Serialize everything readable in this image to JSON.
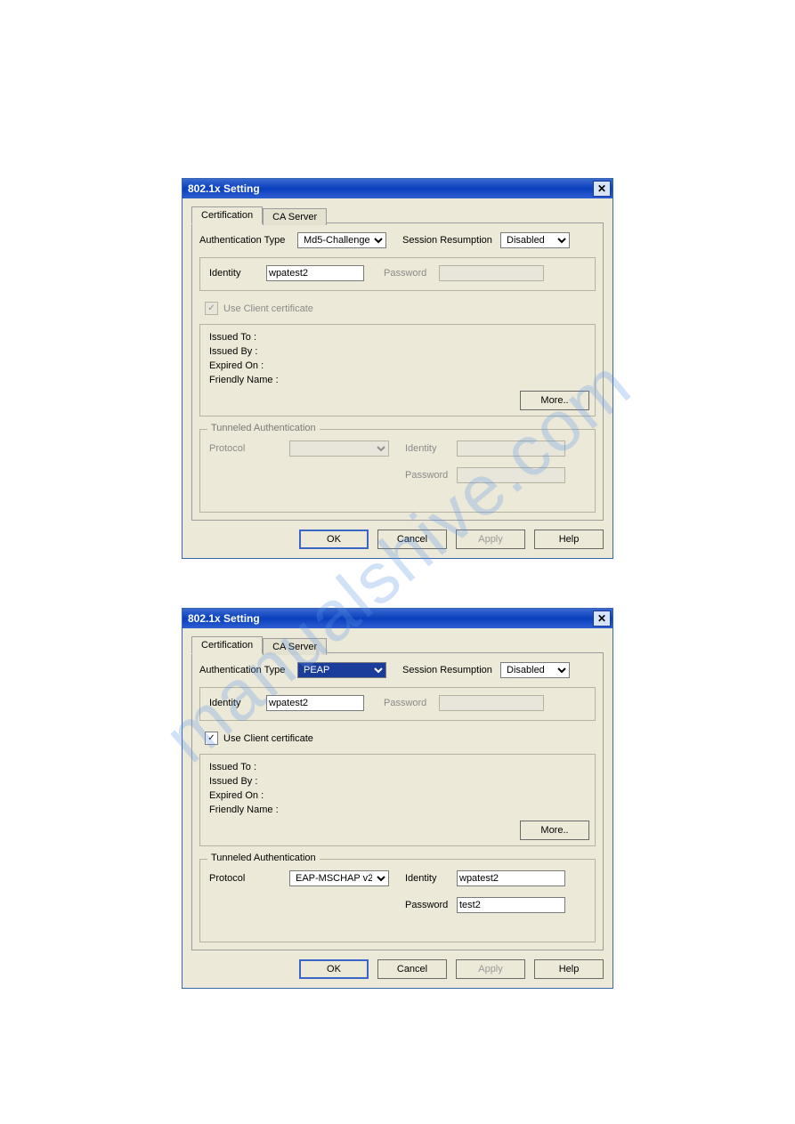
{
  "watermark": "manualshive.com",
  "dialog1": {
    "title": "802.1x Setting",
    "tabs": [
      "Certification",
      "CA Server"
    ],
    "active_tab": 0,
    "auth_type_label": "Authentication Type",
    "auth_type_value": "Md5-Challenge",
    "session_label": "Session Resumption",
    "session_value": "Disabled",
    "identity_label": "Identity",
    "identity_value": "wpatest2",
    "password_label": "Password",
    "password_value": "",
    "use_client_cert_label": "Use Client certificate",
    "use_client_cert_checked": true,
    "cert": {
      "issued_to": "Issued To :",
      "issued_by": "Issued By :",
      "expired_on": "Expired On :",
      "friendly_name": "Friendly Name :",
      "more_btn": "More.."
    },
    "tunneled": {
      "title": "Tunneled Authentication",
      "protocol_label": "Protocol",
      "protocol_value": "",
      "identity_label": "Identity",
      "identity_value": "",
      "password_label": "Password",
      "password_value": ""
    },
    "buttons": {
      "ok": "OK",
      "cancel": "Cancel",
      "apply": "Apply",
      "help": "Help"
    }
  },
  "dialog2": {
    "title": "802.1x Setting",
    "tabs": [
      "Certification",
      "CA Server"
    ],
    "active_tab": 0,
    "auth_type_label": "Authentication Type",
    "auth_type_value": "PEAP",
    "session_label": "Session Resumption",
    "session_value": "Disabled",
    "identity_label": "Identity",
    "identity_value": "wpatest2",
    "password_label": "Password",
    "password_value": "",
    "use_client_cert_label": "Use Client certificate",
    "use_client_cert_checked": true,
    "cert": {
      "issued_to": "Issued To :",
      "issued_by": "Issued By :",
      "expired_on": "Expired On :",
      "friendly_name": "Friendly Name :",
      "more_btn": "More.."
    },
    "tunneled": {
      "title": "Tunneled Authentication",
      "protocol_label": "Protocol",
      "protocol_value": "EAP-MSCHAP v2",
      "identity_label": "Identity",
      "identity_value": "wpatest2",
      "password_label": "Password",
      "password_value": "test2"
    },
    "buttons": {
      "ok": "OK",
      "cancel": "Cancel",
      "apply": "Apply",
      "help": "Help"
    }
  }
}
